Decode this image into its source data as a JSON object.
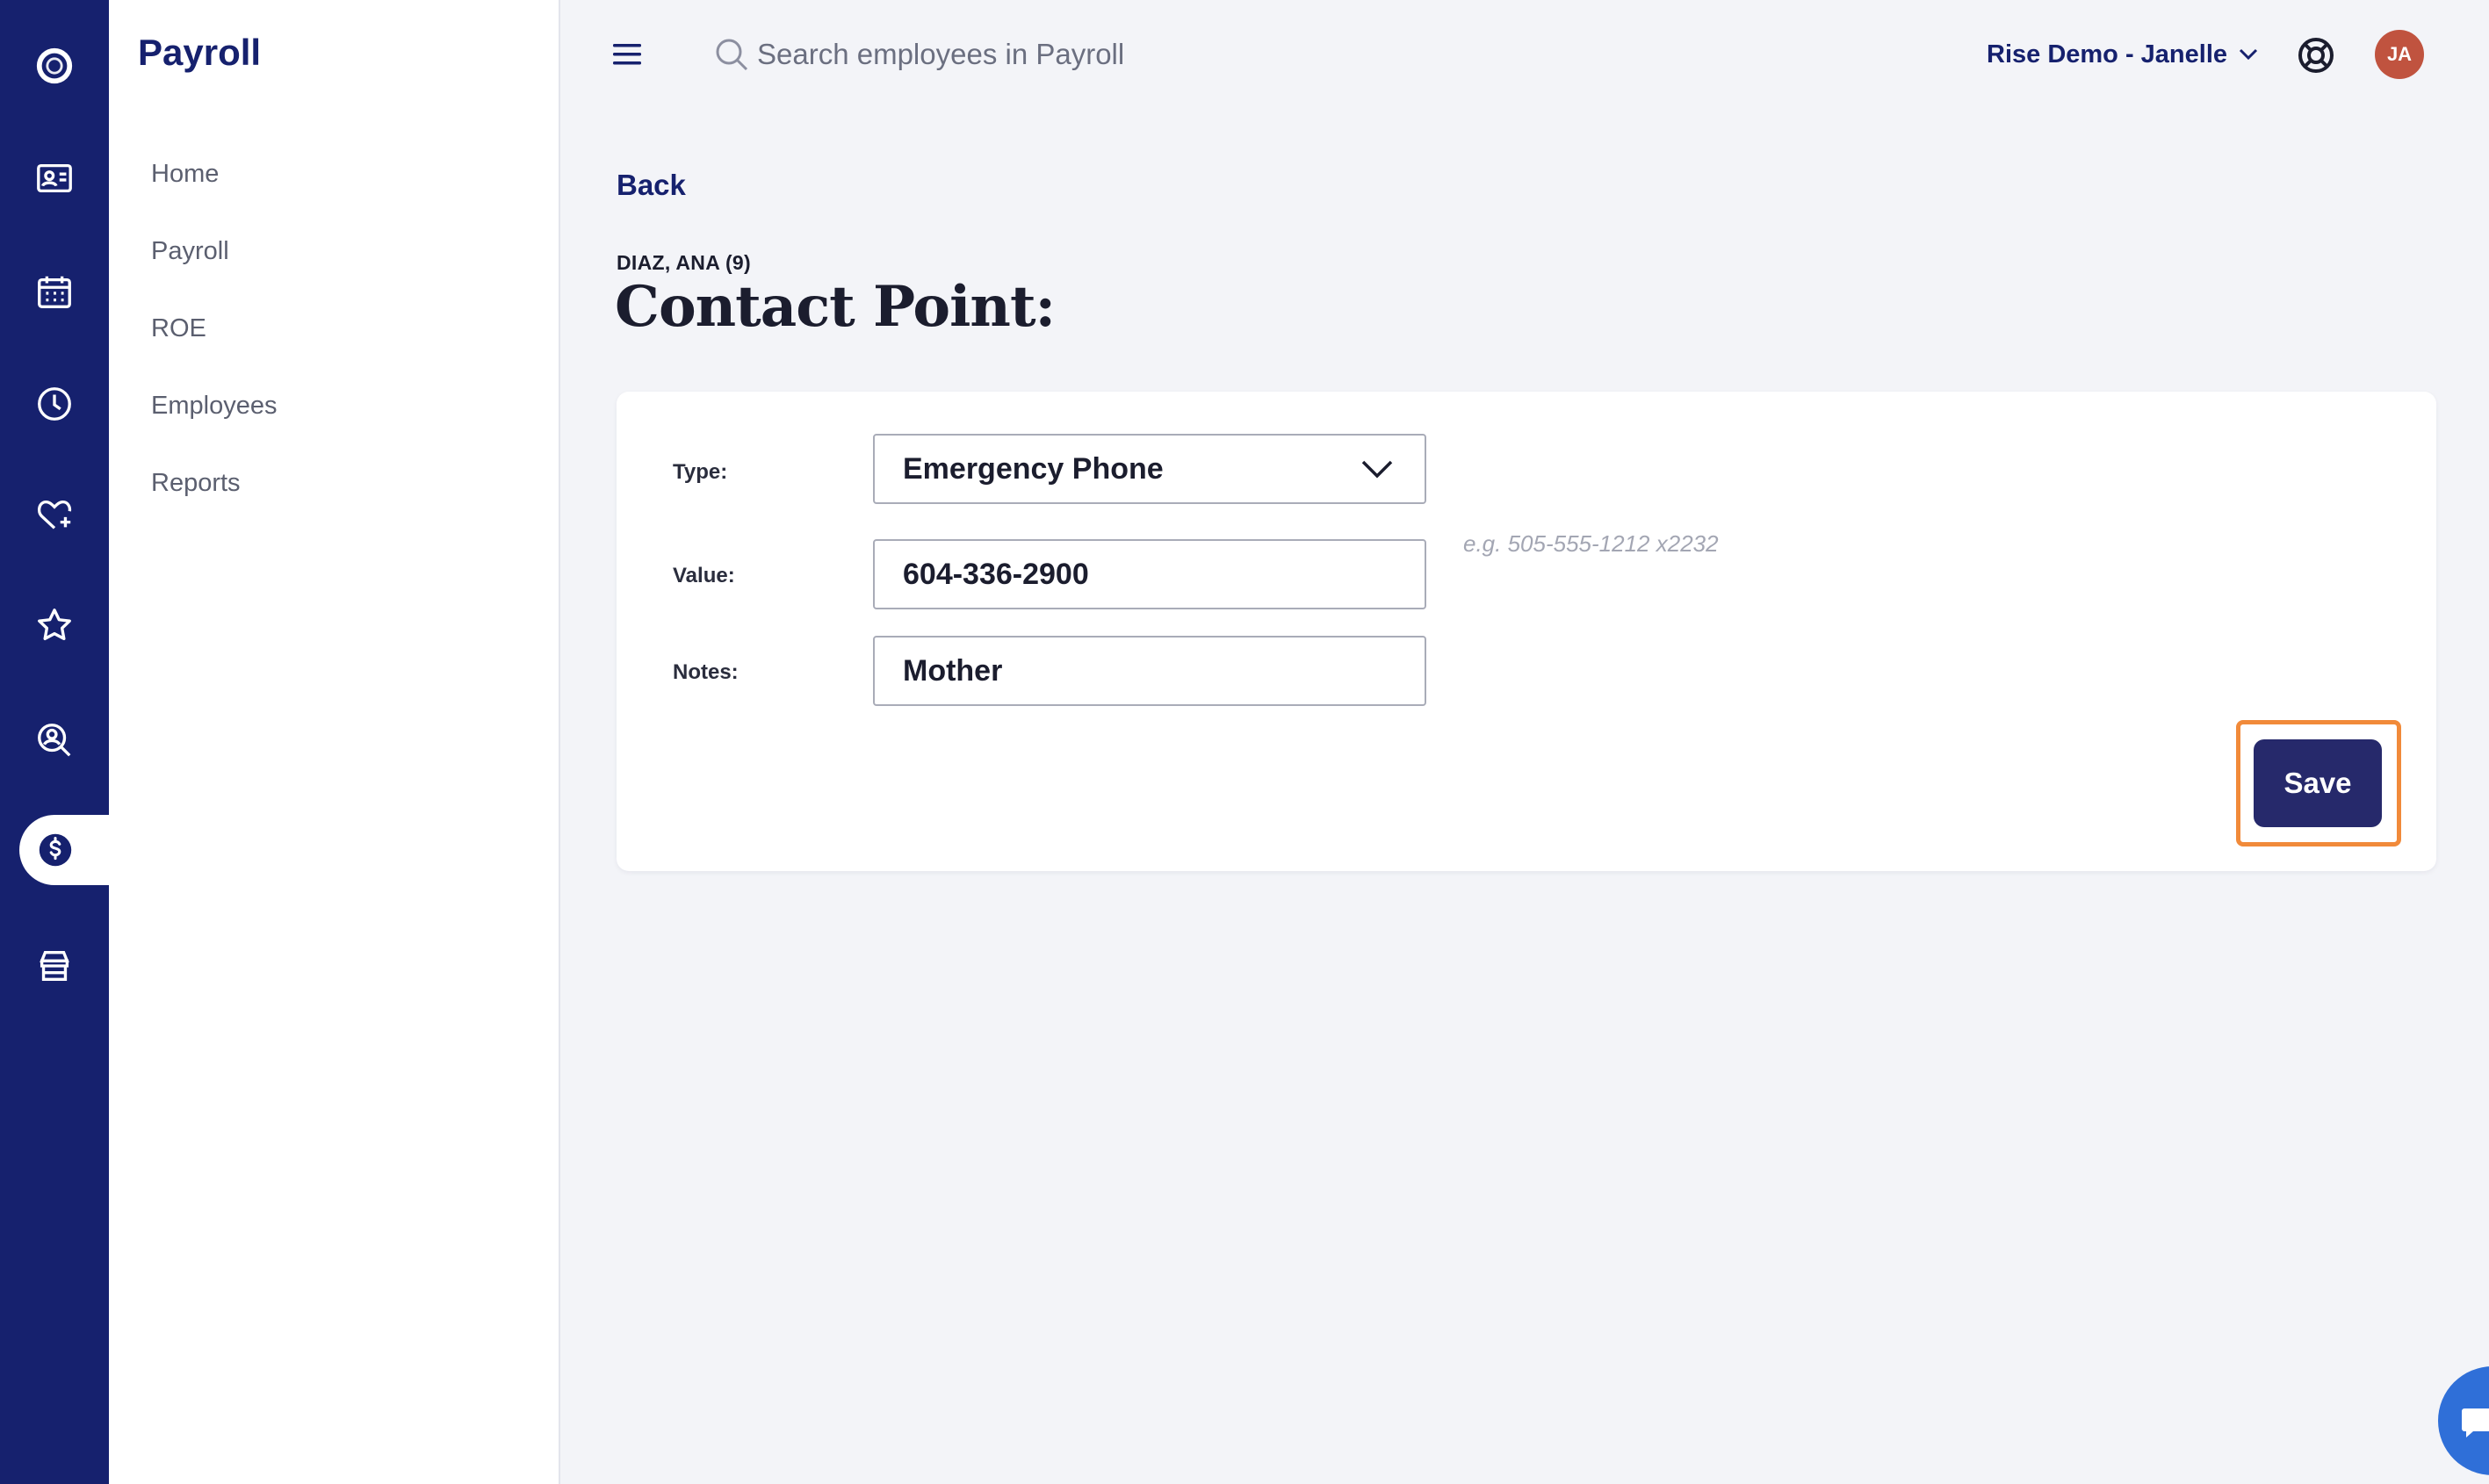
{
  "app": {
    "section_title": "Payroll",
    "accent_color": "#16216e",
    "highlight_color": "#f18a3a"
  },
  "rail": {
    "items": [
      {
        "icon": "logo-icon"
      },
      {
        "icon": "id-card-icon"
      },
      {
        "icon": "calendar-icon"
      },
      {
        "icon": "clock-icon"
      },
      {
        "icon": "heart-plus-icon"
      },
      {
        "icon": "star-icon"
      },
      {
        "icon": "search-person-icon"
      },
      {
        "icon": "dollar-icon",
        "active": true
      },
      {
        "icon": "store-icon"
      }
    ]
  },
  "subnav": {
    "items": [
      {
        "label": "Home"
      },
      {
        "label": "Payroll"
      },
      {
        "label": "ROE"
      },
      {
        "label": "Employees"
      },
      {
        "label": "Reports"
      }
    ]
  },
  "topbar": {
    "search_placeholder": "Search employees in Payroll",
    "org_name": "Rise Demo - Janelle",
    "avatar_initials": "JA"
  },
  "page": {
    "back_label": "Back",
    "employee": "DIAZ, ANA (9)",
    "title": "Contact Point:"
  },
  "form": {
    "type_label": "Type:",
    "type_value": "Emergency Phone",
    "value_label": "Value:",
    "value_value": "604-336-2900",
    "value_hint": "e.g. 505-555-1212 x2232",
    "notes_label": "Notes:",
    "notes_value": "Mother",
    "save_label": "Save"
  }
}
